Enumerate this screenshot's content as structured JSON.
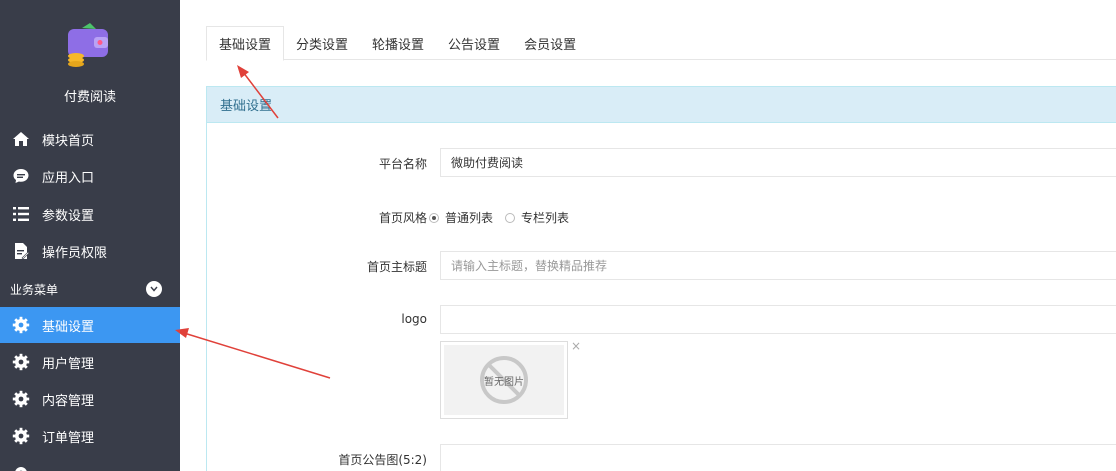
{
  "sidebar": {
    "app_title": "付费阅读",
    "top_items": [
      {
        "label": "模块首页",
        "icon": "home-icon"
      },
      {
        "label": "应用入口",
        "icon": "chat-bubble-icon"
      },
      {
        "label": "参数设置",
        "icon": "list-settings-icon"
      },
      {
        "label": "操作员权限",
        "icon": "document-edit-icon"
      }
    ],
    "section_title": "业务菜单",
    "section_items": [
      {
        "label": "基础设置",
        "icon": "gear-icon",
        "active": true
      },
      {
        "label": "用户管理",
        "icon": "gear-icon"
      },
      {
        "label": "内容管理",
        "icon": "gear-icon"
      },
      {
        "label": "订单管理",
        "icon": "gear-icon"
      }
    ],
    "active_color": "#3c97f2",
    "bg_color": "#393d49"
  },
  "tabs": [
    {
      "label": "基础设置",
      "active": true
    },
    {
      "label": "分类设置"
    },
    {
      "label": "轮播设置"
    },
    {
      "label": "公告设置"
    },
    {
      "label": "会员设置"
    }
  ],
  "panel": {
    "title": "基础设置",
    "fields": {
      "platform_name": {
        "label": "平台名称",
        "value": "微助付费阅读"
      },
      "home_style": {
        "label": "首页风格",
        "options": [
          "普通列表",
          "专栏列表"
        ],
        "selected": "普通列表"
      },
      "home_title": {
        "label": "首页主标题",
        "placeholder": "请输入主标题，替换精品推荐"
      },
      "logo": {
        "label": "logo",
        "value": "",
        "thumb_text": "暂无图片",
        "close_symbol": "×"
      },
      "notice_image": {
        "label": "首页公告图(5:2)"
      }
    }
  },
  "annotation_color": "#e0413a"
}
